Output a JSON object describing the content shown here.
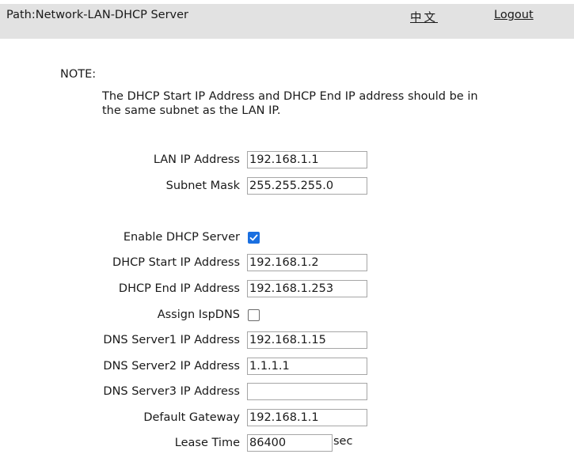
{
  "header": {
    "path": "Path:Network-LAN-DHCP Server",
    "language_link": "中文",
    "logout_link": "Logout"
  },
  "note": {
    "title": "NOTE:",
    "text": "The DHCP Start IP Address and DHCP End IP address should be in the same subnet as the LAN IP."
  },
  "form": {
    "lan_ip": {
      "label": "LAN IP Address",
      "value": "192.168.1.1"
    },
    "subnet_mask": {
      "label": "Subnet Mask",
      "value": "255.255.255.0"
    },
    "enable_dhcp": {
      "label": "Enable DHCP Server",
      "checked": true
    },
    "dhcp_start": {
      "label": "DHCP Start IP Address",
      "value": "192.168.1.2"
    },
    "dhcp_end": {
      "label": "DHCP End IP Address",
      "value": "192.168.1.253"
    },
    "assign_isp_dns": {
      "label": "Assign IspDNS",
      "checked": false
    },
    "dns1": {
      "label": "DNS Server1 IP Address",
      "value": "192.168.1.15"
    },
    "dns2": {
      "label": "DNS Server2 IP Address",
      "value": "1.1.1.1"
    },
    "dns3": {
      "label": "DNS Server3 IP Address",
      "value": ""
    },
    "gateway": {
      "label": "Default Gateway",
      "value": "192.168.1.1"
    },
    "lease_time": {
      "label": "Lease Time",
      "value": "86400",
      "unit": "sec"
    }
  },
  "colors": {
    "header_bg": "#e2e2e2",
    "checkbox_checked": "#1a6fe0",
    "field_border": "#a6a6a6"
  },
  "icons": {
    "checkmark": "checkmark-icon"
  }
}
